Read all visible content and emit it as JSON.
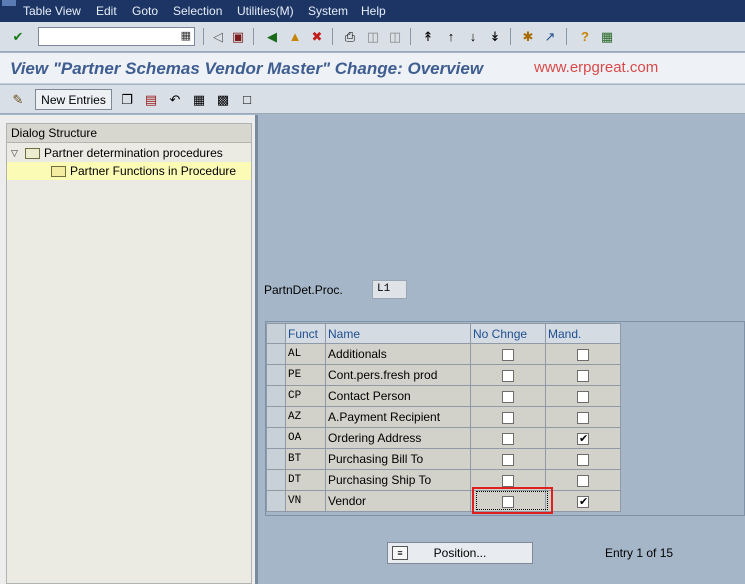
{
  "menu": {
    "items": [
      "Table View",
      "Edit",
      "Goto",
      "Selection",
      "Utilities(M)",
      "System",
      "Help"
    ]
  },
  "toolbar": {
    "command_value": "",
    "icons": [
      "enter-icon",
      "back-icon",
      "exit-icon",
      "cancel-icon",
      "print-icon",
      "find-icon",
      "find-next-icon",
      "first-page-icon",
      "previous-page-icon",
      "next-page-icon",
      "last-page-icon",
      "create-session-icon",
      "shortcut-icon",
      "help-icon",
      "customize-layout-icon"
    ]
  },
  "title": {
    "text": "View \"Partner Schemas Vendor Master\" Change: Overview",
    "watermark": "www.erpgreat.com"
  },
  "app_toolbar": {
    "new_entries": "New Entries"
  },
  "dialog_structure": {
    "heading": "Dialog Structure",
    "items": [
      {
        "label": "Partner determination procedures",
        "expanded": true
      },
      {
        "label": "Partner Functions in Procedure",
        "selected": true
      }
    ]
  },
  "header_field": {
    "label": "PartnDet.Proc.",
    "value": "L1"
  },
  "grid": {
    "columns": [
      "Funct",
      "Name",
      "No Chnge",
      "Mand."
    ],
    "rows": [
      {
        "funct": "AL",
        "name": "Additionals",
        "no_change": false,
        "mandatory": false
      },
      {
        "funct": "PE",
        "name": "Cont.pers.fresh prod",
        "no_change": false,
        "mandatory": false
      },
      {
        "funct": "CP",
        "name": "Contact Person",
        "no_change": false,
        "mandatory": false
      },
      {
        "funct": "AZ",
        "name": "A.Payment Recipient",
        "no_change": false,
        "mandatory": false
      },
      {
        "funct": "OA",
        "name": "Ordering Address",
        "no_change": false,
        "mandatory": true
      },
      {
        "funct": "BT",
        "name": "Purchasing Bill To",
        "no_change": false,
        "mandatory": false
      },
      {
        "funct": "DT",
        "name": "Purchasing Ship To",
        "no_change": false,
        "mandatory": false
      },
      {
        "funct": "VN",
        "name": "Vendor",
        "no_change": false,
        "mandatory": true
      }
    ]
  },
  "footer": {
    "position_label": "Position...",
    "entry_info": "Entry 1 of 15"
  },
  "colors": {
    "title": "#3e5d90",
    "watermark": "#d84a4a",
    "highlight": "#e02020",
    "background": "#a5b6c9"
  }
}
